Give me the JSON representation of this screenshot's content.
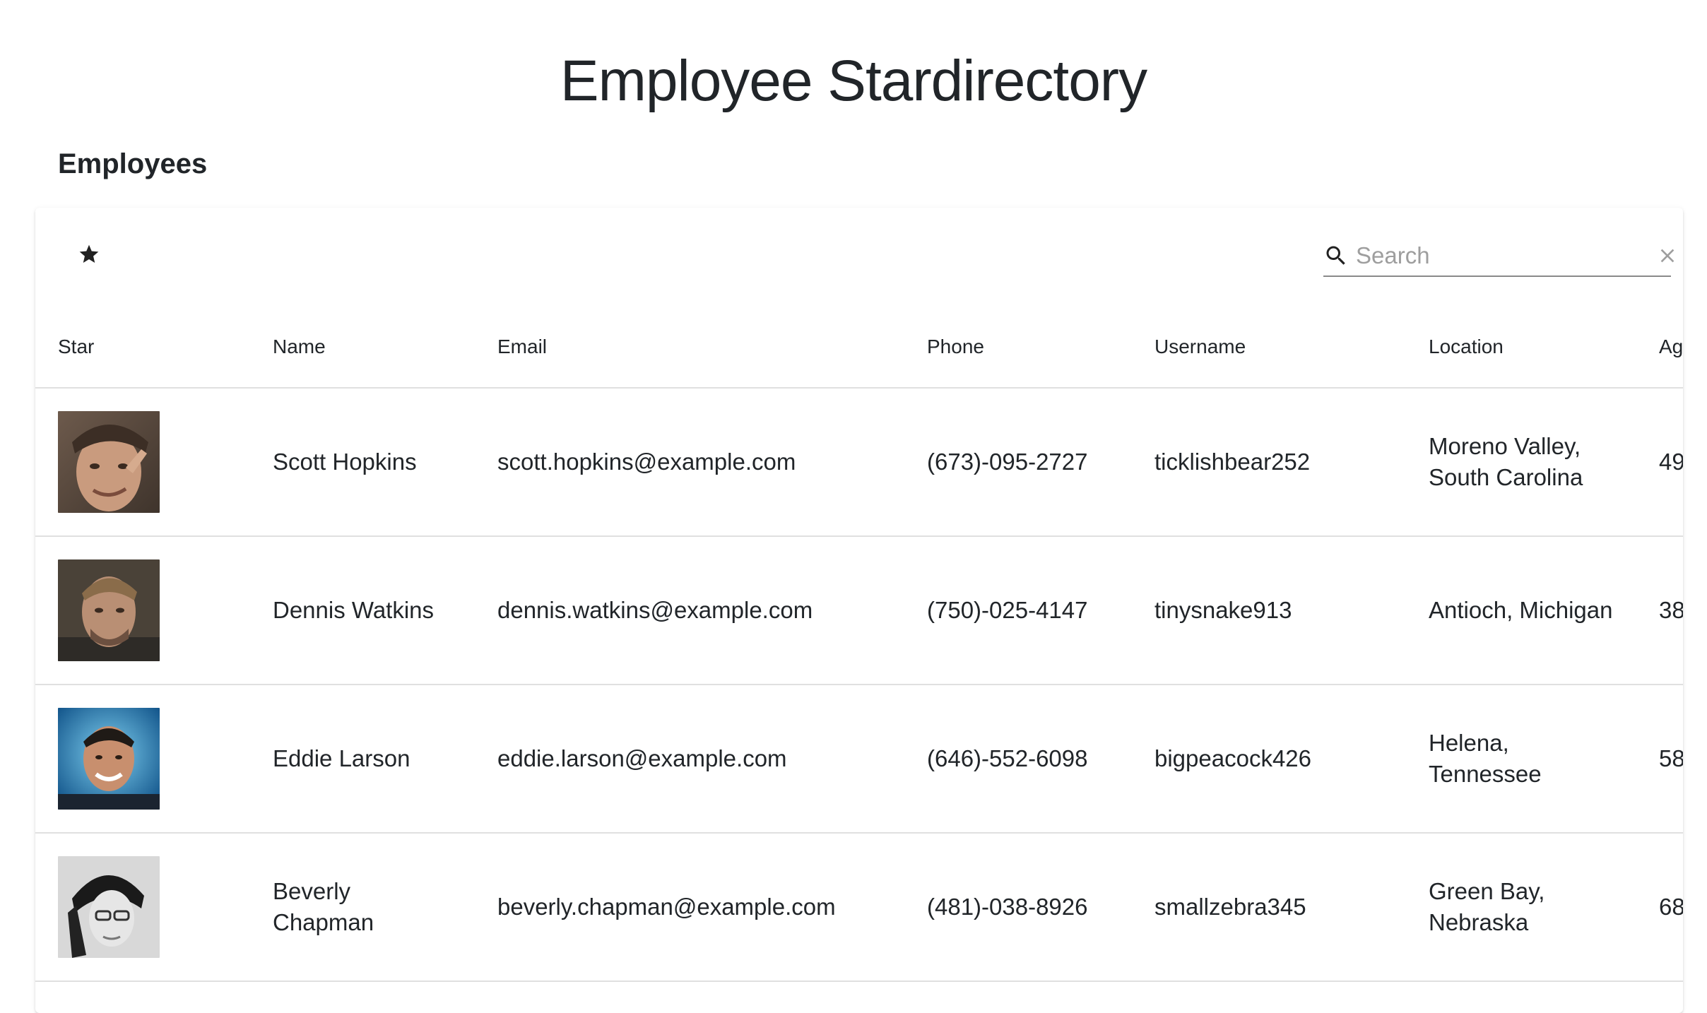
{
  "app": {
    "title": "Employee Stardirectory",
    "section": "Employees"
  },
  "toolbar": {
    "star_icon": "star-icon",
    "search": {
      "placeholder": "Search",
      "value": "",
      "icon": "search-icon",
      "clear_icon": "close-icon"
    }
  },
  "table": {
    "columns": [
      "Star",
      "Name",
      "Email",
      "Phone",
      "Username",
      "Location",
      "Age"
    ],
    "rows": [
      {
        "avatar": "avatar-scott-hopkins",
        "name": "Scott Hopkins",
        "email": "scott.hopkins@example.com",
        "phone": "(673)-095-2727",
        "username": "ticklishbear252",
        "location": "Moreno Valley, South Carolina",
        "age": "49"
      },
      {
        "avatar": "avatar-dennis-watkins",
        "name": "Dennis Watkins",
        "email": "dennis.watkins@example.com",
        "phone": "(750)-025-4147",
        "username": "tinysnake913",
        "location": "Antioch, Michigan",
        "age": "38"
      },
      {
        "avatar": "avatar-eddie-larson",
        "name": "Eddie Larson",
        "email": "eddie.larson@example.com",
        "phone": "(646)-552-6098",
        "username": "bigpeacock426",
        "location": "Helena, Tennessee",
        "age": "58"
      },
      {
        "avatar": "avatar-beverly-chapman",
        "name": "Beverly Chapman",
        "email": "beverly.chapman@example.com",
        "phone": "(481)-038-8926",
        "username": "smallzebra345",
        "location": "Green Bay, Nebraska",
        "age": "68"
      }
    ]
  }
}
